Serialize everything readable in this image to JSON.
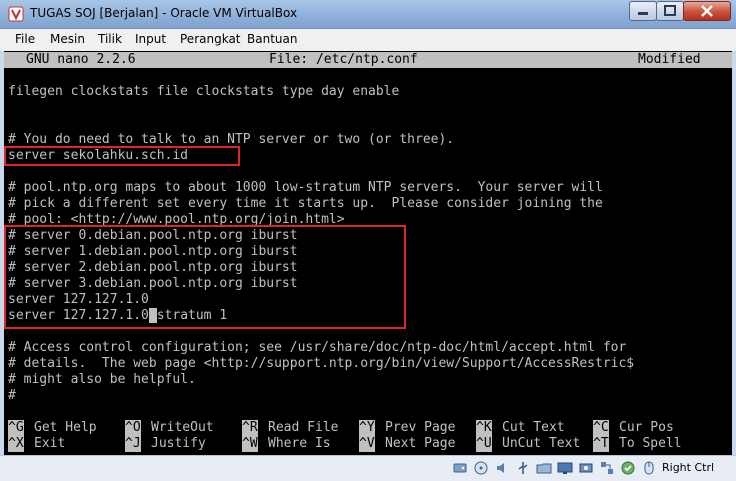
{
  "window": {
    "title": "TUGAS SOJ [Berjalan] - Oracle VM VirtualBox"
  },
  "menubar": {
    "items": [
      "File",
      "Mesin",
      "Tilik",
      "Input",
      "Perangkat",
      "Bantuan"
    ]
  },
  "nano": {
    "version_label": "GNU nano 2.2.6",
    "file_label": "File: /etc/ntp.conf",
    "state_label": "Modified"
  },
  "file_lines": [
    "filegen clockstats file clockstats type day enable",
    "",
    "",
    "# You do need to talk to an NTP server or two (or three).",
    "server sekolahku.sch.id",
    "",
    "# pool.ntp.org maps to about 1000 low-stratum NTP servers.  Your server will",
    "# pick a different set every time it starts up.  Please consider joining the",
    "# pool: <http://www.pool.ntp.org/join.html>",
    "# server 0.debian.pool.ntp.org iburst",
    "# server 1.debian.pool.ntp.org iburst",
    "# server 2.debian.pool.ntp.org iburst",
    "# server 3.debian.pool.ntp.org iburst",
    "server 127.127.1.0",
    "server 127.127.1.0",
    "",
    "# Access control configuration; see /usr/share/doc/ntp-doc/html/accept.html for",
    "# details.  The web page <http://support.ntp.org/bin/view/Support/AccessRestric$",
    "# might also be helpful.",
    "#"
  ],
  "cursor_line": {
    "cursor_char": " ",
    "after_cursor": "stratum 1"
  },
  "shortcuts": {
    "row1": [
      {
        "key": "^G",
        "label": "Get Help"
      },
      {
        "key": "^O",
        "label": "WriteOut"
      },
      {
        "key": "^R",
        "label": "Read File"
      },
      {
        "key": "^Y",
        "label": "Prev Page"
      },
      {
        "key": "^K",
        "label": "Cut Text"
      },
      {
        "key": "^C",
        "label": "Cur Pos"
      }
    ],
    "row2": [
      {
        "key": "^X",
        "label": "Exit"
      },
      {
        "key": "^J",
        "label": "Justify"
      },
      {
        "key": "^W",
        "label": "Where Is"
      },
      {
        "key": "^V",
        "label": "Next Page"
      },
      {
        "key": "^U",
        "label": "UnCut Text"
      },
      {
        "key": "^T",
        "label": "To Spell"
      }
    ]
  },
  "statusbar": {
    "host_key": "Right Ctrl",
    "icons": [
      "hard-disk-icon",
      "optical-drive-icon",
      "audio-icon",
      "usb-icon",
      "shared-folders-icon",
      "display-icon",
      "video-capture-icon",
      "network-icon",
      "cpu-icon",
      "mouse-integration-icon",
      "keyboard-capture-icon"
    ]
  },
  "colors": {
    "highlight_box": "#e0242b",
    "terminal_bg": "#000000",
    "terminal_fg": "#c0c0c0"
  }
}
